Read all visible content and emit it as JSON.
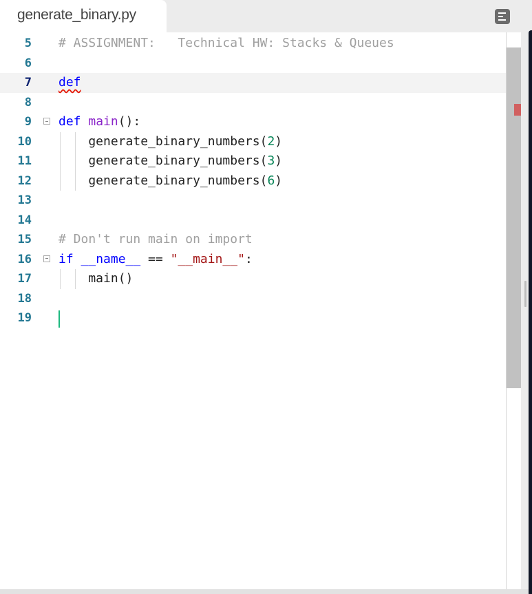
{
  "tab": {
    "filename": "generate_binary.py"
  },
  "toolbar": {
    "menu_icon": "outline-menu-icon"
  },
  "editor": {
    "active_line": 7,
    "lines": [
      {
        "n": "5",
        "tokens": [
          {
            "t": "# ASSIGNMENT:   Technical HW: Stacks & Queues",
            "c": "cmt"
          }
        ]
      },
      {
        "n": "6",
        "tokens": []
      },
      {
        "n": "7",
        "tokens": [
          {
            "t": "def",
            "c": "kw squiggle"
          }
        ]
      },
      {
        "n": "8",
        "tokens": []
      },
      {
        "n": "9",
        "fold": true,
        "tokens": [
          {
            "t": "def ",
            "c": "kw"
          },
          {
            "t": "main",
            "c": "fnm"
          },
          {
            "t": "():",
            "c": "plain"
          }
        ]
      },
      {
        "n": "10",
        "guides": 2,
        "tokens": [
          {
            "t": "    generate_binary_numbers(",
            "c": "plain"
          },
          {
            "t": "2",
            "c": "num"
          },
          {
            "t": ")",
            "c": "plain"
          }
        ]
      },
      {
        "n": "11",
        "guides": 2,
        "tokens": [
          {
            "t": "    generate_binary_numbers(",
            "c": "plain"
          },
          {
            "t": "3",
            "c": "num"
          },
          {
            "t": ")",
            "c": "plain"
          }
        ]
      },
      {
        "n": "12",
        "guides": 2,
        "tokens": [
          {
            "t": "    generate_binary_numbers(",
            "c": "plain"
          },
          {
            "t": "6",
            "c": "num"
          },
          {
            "t": ")",
            "c": "plain"
          }
        ]
      },
      {
        "n": "13",
        "tokens": []
      },
      {
        "n": "14",
        "tokens": []
      },
      {
        "n": "15",
        "tokens": [
          {
            "t": "# Don't run main on import",
            "c": "cmt"
          }
        ]
      },
      {
        "n": "16",
        "fold": true,
        "tokens": [
          {
            "t": "if ",
            "c": "kw"
          },
          {
            "t": "__name__",
            "c": "kw"
          },
          {
            "t": " == ",
            "c": "plain"
          },
          {
            "t": "\"__main__\"",
            "c": "str"
          },
          {
            "t": ":",
            "c": "plain"
          }
        ]
      },
      {
        "n": "17",
        "guides": 2,
        "tokens": [
          {
            "t": "    main()",
            "c": "plain"
          }
        ]
      },
      {
        "n": "18",
        "tokens": []
      },
      {
        "n": "19",
        "cursor": true,
        "tokens": []
      }
    ]
  },
  "colors": {
    "keyword": "#0000ff",
    "function": "#8b26c9",
    "number": "#098658",
    "string": "#a31515",
    "comment": "#a0a0a0",
    "line_number": "#237893",
    "cursor": "#1eb980",
    "error": "#d16060"
  }
}
